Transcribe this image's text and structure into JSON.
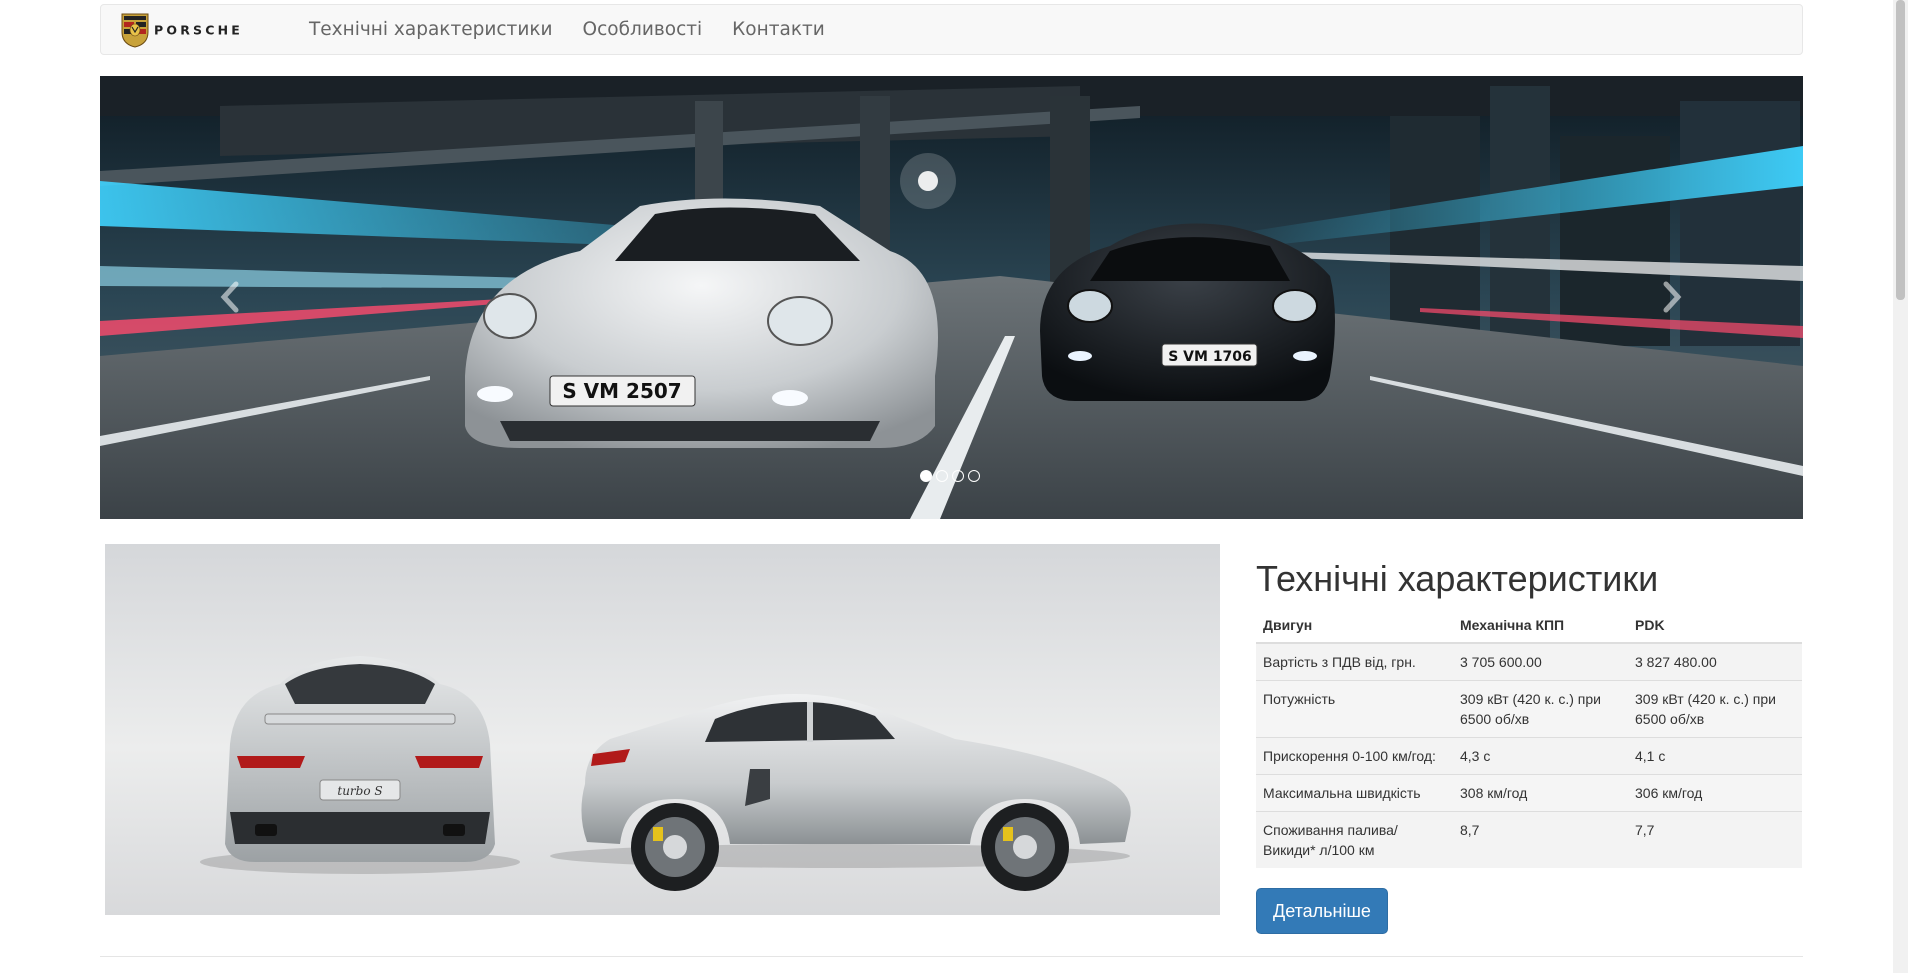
{
  "brand": {
    "wordmark": "PORSCHE",
    "logo_icon": "porsche-crest-icon"
  },
  "nav": {
    "items": [
      {
        "label": "Технічні характеристики"
      },
      {
        "label": "Особливості"
      },
      {
        "label": "Контакти"
      }
    ]
  },
  "carousel": {
    "prev_icon": "chevron-left-icon",
    "next_icon": "chevron-right-icon",
    "slide_count": 4,
    "active_slide": 1,
    "plates": [
      "S VM 2507",
      "S VM 1706"
    ]
  },
  "product_image": {
    "badge_text": "turbo S"
  },
  "specs": {
    "title": "Технічні характеристики",
    "headers": [
      "Двигун",
      "Механічна КПП",
      "PDK"
    ],
    "rows": [
      [
        "Вартість з ПДВ від, грн.",
        "3 705 600.00",
        "3 827 480.00"
      ],
      [
        "Потужність",
        "309 кВт (420 к. с.) при 6500 об/хв",
        "309 кВт (420 к. с.) при 6500 об/хв"
      ],
      [
        "Прискорення 0-100 км/год:",
        "4,3 с",
        "4,1 с"
      ],
      [
        "Максимальна швидкість",
        "308 км/год",
        "306 км/год"
      ],
      [
        "Споживання палива/ Викиди* л/100 км",
        "8,7",
        "7,7"
      ]
    ],
    "button_label": "Детальніше"
  },
  "colors": {
    "primary": "#337ab7",
    "navbar_bg": "#f8f8f8",
    "nav_text": "#666666"
  }
}
